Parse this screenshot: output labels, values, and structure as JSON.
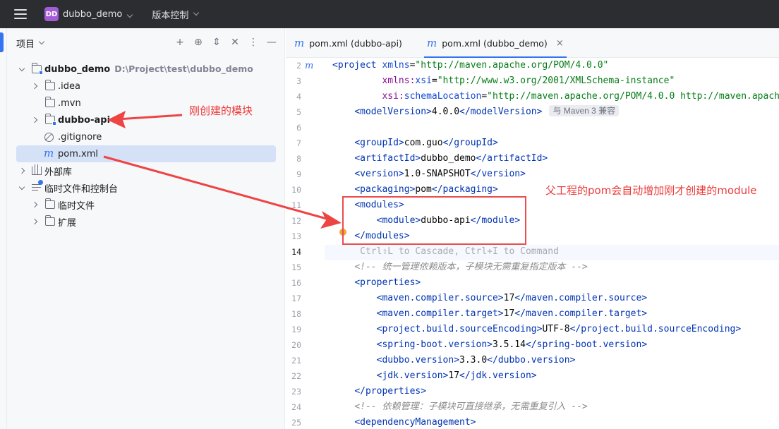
{
  "titlebar": {
    "project_badge": "DD",
    "project_name": "dubbo_demo",
    "vcs_label": "版本控制"
  },
  "panel": {
    "title": "项目",
    "tools": [
      "+",
      "⊕",
      "⇕",
      "✕",
      "⋮",
      "—"
    ]
  },
  "tree": {
    "root": {
      "label": "dubbo_demo",
      "path": "D:\\Project\\test\\dubbo_demo"
    },
    "items": [
      {
        "label": ".idea"
      },
      {
        "label": ".mvn"
      },
      {
        "label": "dubbo-api"
      },
      {
        "label": ".gitignore"
      },
      {
        "label": "pom.xml"
      },
      {
        "label": "外部库"
      },
      {
        "label": "临时文件和控制台"
      },
      {
        "label": "临时文件"
      },
      {
        "label": "扩展"
      }
    ]
  },
  "tabs": [
    {
      "icon": "m",
      "label": "pom.xml (dubbo-api)"
    },
    {
      "icon": "m",
      "label": "pom.xml (dubbo_demo)",
      "close": "×"
    }
  ],
  "editor": {
    "line_numbers": [
      "2",
      "3",
      "4",
      "5",
      "6",
      "7",
      "8",
      "9",
      "10",
      "11",
      "12",
      "13",
      "14",
      "15",
      "16",
      "17",
      "18",
      "19",
      "20",
      "21",
      "22",
      "23",
      "24",
      "25"
    ],
    "gutter_icon": "m",
    "maven_inlay": "与 Maven 3 兼容",
    "hint_line": "Ctrl⇧L to Cascade, Ctrl+I to Command",
    "comment_1": "<!-- 统一管理依赖版本，子模块无需重复指定版本 -->",
    "comment_2": "<!-- 依赖管理：子模块可直接继承，无需重复引入 -->"
  },
  "annotations": {
    "module_note": "刚创建的模块",
    "pom_note": "父工程的pom会自动增加刚才创建的module"
  },
  "colors": {
    "accent": "#3574f0",
    "annotation_red": "#ee3a3a",
    "badge": "#a35cd6"
  }
}
